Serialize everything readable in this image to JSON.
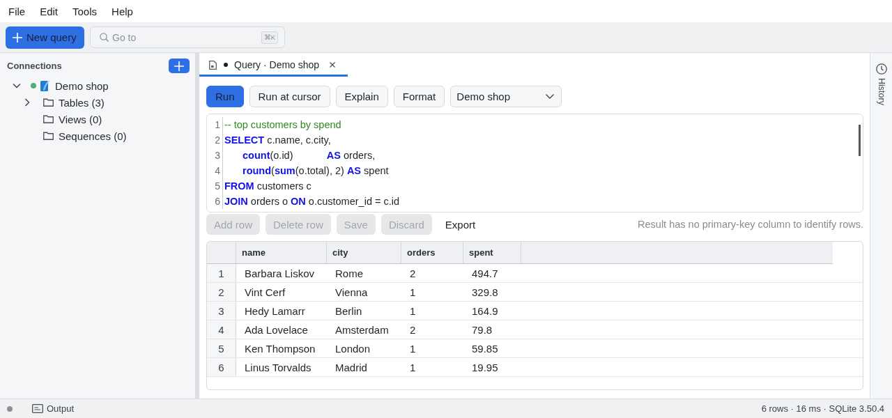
{
  "menu": [
    {
      "label": "File"
    },
    {
      "label": "Edit"
    },
    {
      "label": "Tools"
    },
    {
      "label": "Help"
    }
  ],
  "toolbar": {
    "new_query": {
      "label": "New query"
    },
    "search": {
      "placeholder": "Go to",
      "shortcut": "⌘K"
    }
  },
  "sidebar": {
    "title": "Connections",
    "tree": [
      {
        "label": "Demo shop",
        "kind": "connection",
        "connected": true,
        "expanded": true,
        "children": [
          {
            "label": "Tables (3)",
            "kind": "folder",
            "expanded": false
          },
          {
            "label": "Views (0)",
            "kind": "folder"
          },
          {
            "label": "Sequences (0)",
            "kind": "folder"
          }
        ]
      }
    ]
  },
  "tabs": [
    {
      "label": "Query · Demo shop",
      "modified": true,
      "selected": true
    }
  ],
  "query_toolbar": {
    "buttons": [
      {
        "label": "Run",
        "kind": "primary"
      },
      {
        "label": "Run at cursor",
        "kind": "secondary"
      },
      {
        "label": "Explain",
        "kind": "secondary"
      },
      {
        "label": "Format",
        "kind": "secondary"
      }
    ],
    "connection_select": {
      "value": "Demo shop"
    }
  },
  "editor": {
    "lines": [
      {
        "number": "1",
        "indented": false,
        "tokens": [
          {
            "kind": "comment",
            "text": "-- top customers by spend"
          }
        ]
      },
      {
        "number": "2",
        "indented": false,
        "tokens": [
          {
            "kind": "keyword",
            "text": "SELECT"
          },
          {
            "kind": "plain",
            "text": " c.name, c.city,"
          }
        ]
      },
      {
        "number": "3",
        "indented": true,
        "tokens": [
          {
            "kind": "function",
            "text": "count"
          },
          {
            "kind": "plain",
            "text": "(o.id)            "
          },
          {
            "kind": "keyword",
            "text": "AS"
          },
          {
            "kind": "plain",
            "text": " orders,"
          }
        ]
      },
      {
        "number": "4",
        "indented": true,
        "tokens": [
          {
            "kind": "function",
            "text": "round"
          },
          {
            "kind": "plain",
            "text": "("
          },
          {
            "kind": "function",
            "text": "sum"
          },
          {
            "kind": "plain",
            "text": "(o.total), 2) "
          },
          {
            "kind": "keyword",
            "text": "AS"
          },
          {
            "kind": "plain",
            "text": " spent"
          }
        ]
      },
      {
        "number": "5",
        "indented": false,
        "tokens": [
          {
            "kind": "keyword",
            "text": "FROM"
          },
          {
            "kind": "plain",
            "text": " customers c"
          }
        ]
      },
      {
        "number": "6",
        "indented": false,
        "tokens": [
          {
            "kind": "keyword",
            "text": "JOIN"
          },
          {
            "kind": "plain",
            "text": " orders o "
          },
          {
            "kind": "keyword",
            "text": "ON"
          },
          {
            "kind": "plain",
            "text": " o.customer_id = c.id"
          }
        ]
      }
    ]
  },
  "result_actions": {
    "buttons": [
      {
        "label": "Add row",
        "disabled": true
      },
      {
        "label": "Delete row",
        "disabled": true
      },
      {
        "label": "Save",
        "disabled": true
      },
      {
        "label": "Discard",
        "disabled": true
      },
      {
        "label": "Export",
        "disabled": false
      }
    ],
    "note": "Result has no primary-key column to identify rows."
  },
  "grid": {
    "columns": [
      "name",
      "city",
      "orders",
      "spent"
    ],
    "rows": [
      {
        "number": "1",
        "cells": [
          "Barbara Liskov",
          "Rome",
          "2",
          "494.7"
        ]
      },
      {
        "number": "2",
        "cells": [
          "Vint Cerf",
          "Vienna",
          "1",
          "329.8"
        ]
      },
      {
        "number": "3",
        "cells": [
          "Hedy Lamarr",
          "Berlin",
          "1",
          "164.9"
        ]
      },
      {
        "number": "4",
        "cells": [
          "Ada Lovelace",
          "Amsterdam",
          "2",
          "79.8"
        ]
      },
      {
        "number": "5",
        "cells": [
          "Ken Thompson",
          "London",
          "1",
          "59.85"
        ]
      },
      {
        "number": "6",
        "cells": [
          "Linus Torvalds",
          "Madrid",
          "1",
          "19.95"
        ]
      }
    ]
  },
  "history": {
    "label": "History"
  },
  "status_bar": {
    "output": "Output",
    "summary": "6 rows · 16 ms · SQLite 3.50.4"
  }
}
